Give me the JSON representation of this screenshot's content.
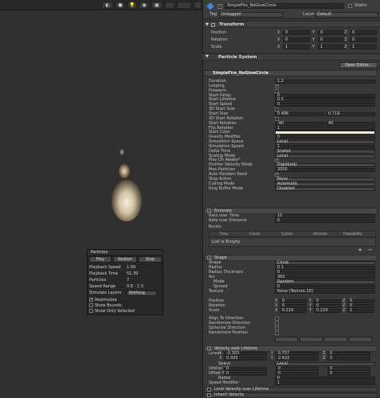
{
  "scene": {
    "toolbar_buttons": [
      "◐",
      "●",
      "💡",
      "◉",
      "▣"
    ],
    "particle_panel": {
      "title": "Particles",
      "buttons": {
        "play": "Play",
        "restart": "Restart",
        "stop": "Stop"
      },
      "rows": [
        {
          "label": "Playback Speed",
          "value": "1.00"
        },
        {
          "label": "Playback Time",
          "value": "51.39"
        },
        {
          "label": "Particles",
          "value": "7"
        },
        {
          "label": "Speed Range",
          "value": "0.8 - 2.3"
        }
      ],
      "simulate_layers": {
        "label": "Simulate Layers",
        "value": "Nothing"
      },
      "checks": [
        {
          "label": "Resimulate",
          "checked": "✓"
        },
        {
          "label": "Show Bounds",
          "checked": ""
        },
        {
          "label": "Show Only Selected",
          "checked": ""
        }
      ]
    }
  },
  "inspector": {
    "object_name": "SimpleFire_NoGlowCircle",
    "static_label": "Static",
    "tag_label": "Tag",
    "tag_value": "Untagged",
    "layer_label": "Layer",
    "layer_value": "Default",
    "transform": {
      "title": "Transform",
      "rows": [
        {
          "label": "Position",
          "x": "0",
          "y": "0",
          "z": "0"
        },
        {
          "label": "Rotation",
          "x": "0",
          "y": "0",
          "z": "0"
        },
        {
          "label": "Scale",
          "x": "1",
          "y": "1",
          "z": "1"
        }
      ]
    },
    "particle_system": {
      "title": "Particle System",
      "open_editor": "Open Editor...",
      "sub_title": "SimpleFire_NoGlowCircle",
      "main_rows": [
        {
          "label": "Duration",
          "value": "1.2",
          "type": "field"
        },
        {
          "label": "Looping",
          "value": "✓",
          "type": "check"
        },
        {
          "label": "Prewarm",
          "value": "",
          "type": "check"
        },
        {
          "label": "Start Delay",
          "value": "0",
          "type": "field"
        },
        {
          "label": "Start Lifetime",
          "value": "0.5",
          "type": "field"
        },
        {
          "label": "Start Speed",
          "value": "0",
          "type": "field"
        },
        {
          "label": "3D Start Size",
          "value": "",
          "type": "check"
        },
        {
          "label": "Start Size",
          "value": "0.486",
          "value2": "0.719",
          "type": "two"
        },
        {
          "label": "3D Start Rotation",
          "value": "",
          "type": "check"
        },
        {
          "label": "Start Rotation",
          "value": "-90",
          "value2": "40",
          "type": "two"
        },
        {
          "label": "Flip Rotation",
          "value": "1",
          "type": "field"
        },
        {
          "label": "Start Color",
          "value": "",
          "type": "color"
        },
        {
          "label": "Gravity Modifier",
          "value": "0",
          "type": "field"
        },
        {
          "label": "Simulation Space",
          "value": "Local",
          "type": "dd"
        },
        {
          "label": "Simulation Speed",
          "value": "1",
          "type": "field"
        },
        {
          "label": "Delta Time",
          "value": "Scaled",
          "type": "dd"
        },
        {
          "label": "Scaling Mode",
          "value": "Local",
          "type": "dd"
        },
        {
          "label": "Play On Awake*",
          "value": "✓",
          "type": "check"
        },
        {
          "label": "Emitter Velocity Mode",
          "value": "Rigidbody",
          "type": "dd"
        },
        {
          "label": "Max Particles",
          "value": "2000",
          "type": "field"
        },
        {
          "label": "Auto Random Seed",
          "value": "✓",
          "type": "check"
        },
        {
          "label": "Stop Action",
          "value": "None",
          "type": "dd"
        },
        {
          "label": "Culling Mode",
          "value": "Automatic",
          "type": "dd"
        },
        {
          "label": "Ring Buffer Mode",
          "value": "Disabled",
          "type": "dd"
        }
      ],
      "emission": {
        "title": "Emission",
        "rows": [
          {
            "label": "Rate over Time",
            "value": "15"
          },
          {
            "label": "Rate over Distance",
            "value": "0"
          }
        ],
        "bursts_label": "Bursts",
        "bursts_cols": [
          "Time",
          "Count",
          "Cycles",
          "Interval",
          "Probability"
        ],
        "list_empty": "List is Empty"
      },
      "shape": {
        "title": "Shape",
        "rows": [
          {
            "label": "Shape",
            "value": "Circle",
            "type": "dd"
          },
          {
            "label": "Radius",
            "value": "0.1",
            "type": "field"
          },
          {
            "label": "Radius Thickness",
            "value": "0",
            "type": "field"
          },
          {
            "label": "Arc",
            "value": "360",
            "type": "field"
          },
          {
            "label": "Mode",
            "value": "Random",
            "type": "dd",
            "indent": true
          },
          {
            "label": "Spread",
            "value": "0",
            "type": "field",
            "indent": true
          },
          {
            "label": "Texture",
            "value": "None (Texture 2D)",
            "type": "field"
          }
        ],
        "xyz_rows": [
          {
            "label": "Position",
            "x": "0",
            "y": "0",
            "z": "0"
          },
          {
            "label": "Rotation",
            "x": "0",
            "y": "0",
            "z": "0"
          },
          {
            "label": "Scale",
            "x": "0.219",
            "y": "0.219",
            "z": "1"
          }
        ],
        "align_rows": [
          {
            "label": "Align To Direction"
          },
          {
            "label": "Randomize Direction"
          },
          {
            "label": "Spherize Direction"
          },
          {
            "label": "Randomize Position"
          }
        ]
      },
      "velocity": {
        "title": "Velocity over Lifetime",
        "linear_label": "Linear",
        "linear": [
          {
            "x": "-0.303",
            "y": "0.757",
            "z": "0"
          },
          {
            "x": "0.303",
            "y": "2.422",
            "z": "0"
          }
        ],
        "space_label": "Space",
        "space_value": "Local",
        "orbital_label": "Orbital X",
        "orbital": {
          "x": "0",
          "y": "0",
          "z": "0"
        },
        "offset_label": "Offset X",
        "offset": {
          "x": "0",
          "y": "0",
          "z": "0"
        },
        "radial_label": "Radial",
        "radial_value": "0",
        "speed_mod_label": "Speed Modifier",
        "speed_mod_value": "1"
      },
      "limit_velocity": {
        "title": "Limit Velocity over Lifetime"
      },
      "inherit_velocity": {
        "title": "Inherit Velocity"
      }
    }
  },
  "colors": {
    "start_color": "#f6e9c8",
    "accent": "#4a86c8"
  }
}
